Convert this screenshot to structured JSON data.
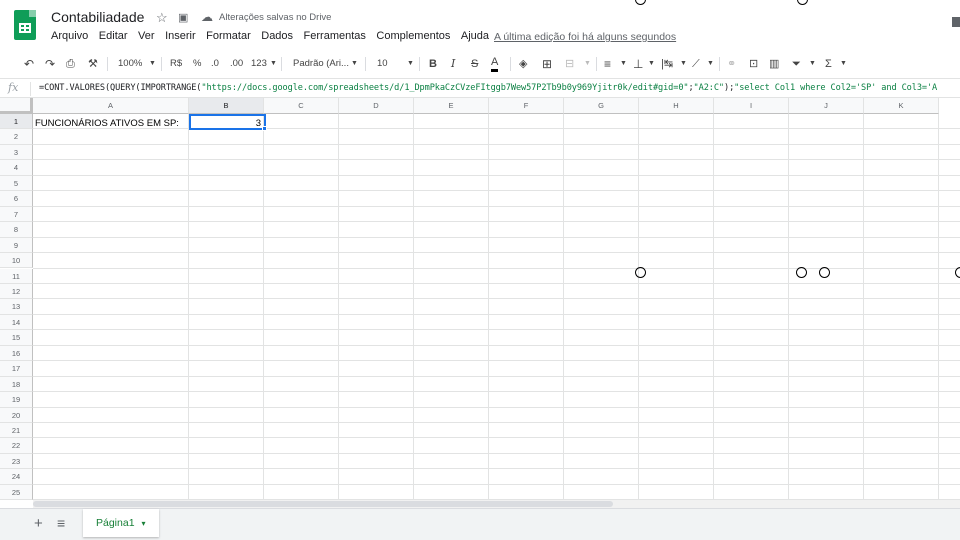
{
  "doc_title": "Contabiliadade",
  "save_status": "Alterações salvas no Drive",
  "menu": [
    "Arquivo",
    "Editar",
    "Ver",
    "Inserir",
    "Formatar",
    "Dados",
    "Ferramentas",
    "Complementos",
    "Ajuda"
  ],
  "last_edit": "A última edição foi há alguns segundos",
  "toolbar": {
    "zoom": "100%",
    "currency": "R$",
    "percent": "%",
    "dec_less": ".0",
    "dec_more": ".00",
    "format": "123",
    "font": "Padrão (Ari...",
    "font_size": "10",
    "bold": "B",
    "italic": "I",
    "strike": "S",
    "text_color": "A",
    "sum": "Σ"
  },
  "formula_bar": {
    "fx": "fx",
    "prefix": "=CONT.VALORES(QUERY(IMPORTRANGE(",
    "url": "\"https://docs.google.com/spreadsheets/d/1_DpmPkaCzCVzeFItggb7Wew57P2Tb9b0y969Yjitr0k/edit#gid=0\"",
    "sep": ";",
    "range": "\"A2:C\"",
    "mid": ");",
    "query": "\"select Col1 where Col2='SP' and Col3='A"
  },
  "columns": [
    "A",
    "B",
    "C",
    "D",
    "E",
    "F",
    "G",
    "H",
    "I",
    "J",
    "K"
  ],
  "rows": [
    "1",
    "2",
    "3",
    "4",
    "5",
    "6",
    "7",
    "8",
    "9",
    "10",
    "11",
    "12",
    "13",
    "14",
    "15",
    "16",
    "17",
    "18",
    "19",
    "20",
    "21",
    "22",
    "23",
    "24",
    "25"
  ],
  "cells": {
    "A1": "FUNCIONÁRIOS ATIVOS EM SP:",
    "B1": "3"
  },
  "sheet_tabs": {
    "add": "+",
    "list": "≡",
    "active": "Página1",
    "active_arrow": "▾"
  },
  "colors": {
    "accent_blue": "#1a73e8",
    "sheets_green": "#0f9d58",
    "formula_string": "#0b8043"
  }
}
